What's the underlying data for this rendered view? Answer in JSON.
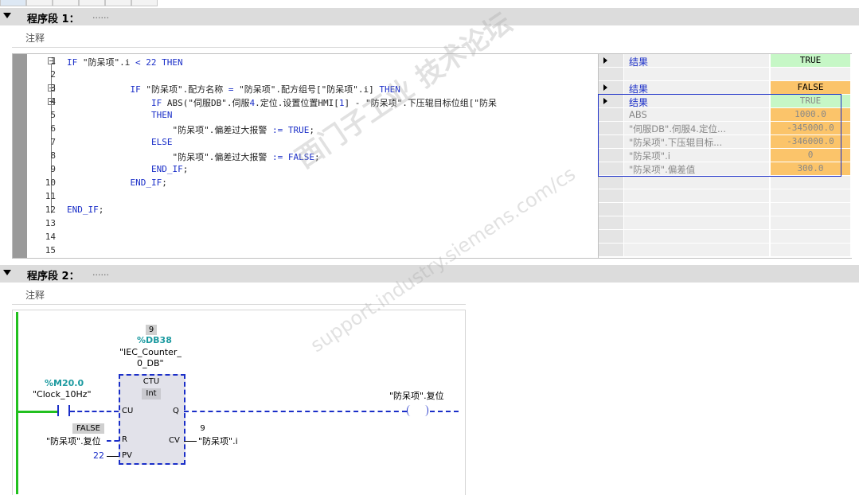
{
  "network1": {
    "title": "程序段 1：",
    "dots": "......",
    "comment": "注释",
    "lines": [
      {
        "no": "1",
        "code": "IF \"防呆项\".i < 22 THEN"
      },
      {
        "no": "2",
        "code": ""
      },
      {
        "no": "3",
        "code": "            IF \"防呆项\".配方名称 = \"防呆项\".配方组号[\"防呆项\".i] THEN"
      },
      {
        "no": "4",
        "code": "                IF ABS(\"伺服DB\".伺服4.定位.设置位置HMI[1] - \"防呆项\".下压辊目标位组[\"防呆"
      },
      {
        "no": "5",
        "code": "                THEN"
      },
      {
        "no": "6",
        "code": "                    \"防呆项\".偏差过大报警 := TRUE;"
      },
      {
        "no": "7",
        "code": "                ELSE"
      },
      {
        "no": "8",
        "code": "                    \"防呆项\".偏差过大报警 := FALSE;"
      },
      {
        "no": "9",
        "code": "                END_IF;"
      },
      {
        "no": "10",
        "code": "            END_IF;"
      },
      {
        "no": "11",
        "code": ""
      },
      {
        "no": "12",
        "code": "END_IF;"
      },
      {
        "no": "13",
        "code": ""
      },
      {
        "no": "14",
        "code": ""
      },
      {
        "no": "15",
        "code": ""
      }
    ],
    "results": [
      {
        "label": "结果",
        "value": "TRUE",
        "color": "#c6f7c6"
      },
      {
        "label": "结果",
        "value": "FALSE",
        "color": "#fbc46a"
      },
      {
        "label": "结果",
        "value": "TRUE",
        "color": "#c6f7c6"
      },
      {
        "label": "ABS",
        "value": "1000.0",
        "color": "#fbc46a"
      },
      {
        "label": "\"伺服DB\".伺服4.定位...",
        "value": "-345000.0",
        "color": "#fbc46a"
      },
      {
        "label": "\"防呆项\".下压辊目标...",
        "value": "-346000.0",
        "color": "#fbc46a"
      },
      {
        "label": "\"防呆项\".i",
        "value": "0",
        "color": "#fbc46a"
      },
      {
        "label": "\"防呆项\".偏差值",
        "value": "300.0",
        "color": "#fbc46a"
      }
    ]
  },
  "network2": {
    "title": "程序段 2：",
    "dots": "......",
    "comment": "注释",
    "instance_number": "9",
    "instance_db": "%DB38",
    "instance_name_1": "\"IEC_Counter_",
    "instance_name_2": "0_DB\"",
    "block_name": "CTU",
    "block_type": "Int",
    "contact_address": "%M20.0",
    "contact_tag": "\"Clock_10Hz\"",
    "pin_cu": "CU",
    "pin_r": "R",
    "pin_pv": "PV",
    "pin_q": "Q",
    "pin_cv": "CV",
    "r_value": "FALSE",
    "r_tag": "\"防呆项\".复位",
    "pv_value": "22",
    "cv_value": "9",
    "cv_tag": "\"防呆项\".i",
    "coil_tag": "\"防呆项\".复位"
  },
  "watermark": {
    "line1": "西门子工业  技术论坛",
    "line2": "support.industry.siemens.com/cs"
  }
}
